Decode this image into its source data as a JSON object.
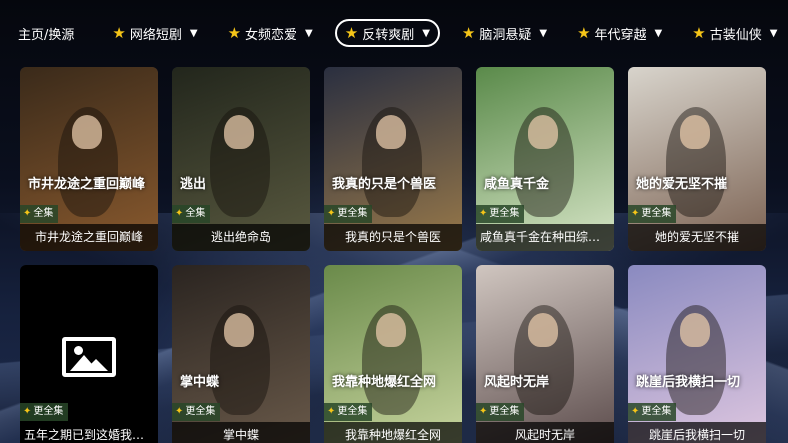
{
  "nav": {
    "items": [
      {
        "label": "主页/换源",
        "starred": false,
        "filter": false,
        "active": false
      },
      {
        "label": "网络短剧",
        "starred": true,
        "filter": true,
        "active": false
      },
      {
        "label": "女频恋爱",
        "starred": true,
        "filter": true,
        "active": false
      },
      {
        "label": "反转爽剧",
        "starred": true,
        "filter": true,
        "active": true
      },
      {
        "label": "脑洞悬疑",
        "starred": true,
        "filter": true,
        "active": false
      },
      {
        "label": "年代穿越",
        "starred": true,
        "filter": true,
        "active": false
      },
      {
        "label": "古装仙侠",
        "starred": true,
        "filter": true,
        "active": false
      }
    ]
  },
  "cards": [
    {
      "title": "市井龙途之重回巅峰",
      "badge": "全集",
      "poster_text": "市井龙途之重回巅峰",
      "colors": [
        "#3a2a1a",
        "#8a5a2e"
      ]
    },
    {
      "title": "逃出绝命岛",
      "badge": "全集",
      "poster_text": "逃出",
      "colors": [
        "#22261c",
        "#5a5a40"
      ]
    },
    {
      "title": "我真的只是个兽医",
      "badge": "更全集",
      "poster_text": "我真的只是个兽医",
      "colors": [
        "#2a2f40",
        "#9a7a4a"
      ]
    },
    {
      "title": "咸鱼真千金在种田综艺爆红了",
      "badge": "更全集",
      "poster_text": "咸鱼真千金",
      "colors": [
        "#5a8a4a",
        "#d8e6c8"
      ]
    },
    {
      "title": "她的爱无坚不摧",
      "badge": "更全集",
      "poster_text": "她的爱无坚不摧",
      "colors": [
        "#d8d4cc",
        "#7a6050"
      ]
    },
    {
      "title": "五年之期已到这婚我不结了",
      "badge": "更全集",
      "poster_text": "",
      "colors": [
        "#000000",
        "#000000"
      ],
      "placeholder": true
    },
    {
      "title": "掌中蝶",
      "badge": "更全集",
      "poster_text": "掌中蝶",
      "colors": [
        "#2a2420",
        "#6a5a4a"
      ]
    },
    {
      "title": "我靠种地爆红全网",
      "badge": "更全集",
      "poster_text": "我靠种地爆红全网",
      "colors": [
        "#6a8a4a",
        "#c9d6a0"
      ]
    },
    {
      "title": "风起时无岸",
      "badge": "更全集",
      "poster_text": "风起时无岸",
      "colors": [
        "#d0c6c0",
        "#5a4a4a"
      ]
    },
    {
      "title": "跳崖后我横扫一切",
      "badge": "更全集",
      "poster_text": "跳崖后我横扫一切",
      "colors": [
        "#8a8ac0",
        "#e0c8e0"
      ]
    }
  ],
  "icons": {
    "star": "star-icon",
    "filter": "filter-icon",
    "placeholder": "image-placeholder-icon"
  },
  "accent": "#f5c518"
}
